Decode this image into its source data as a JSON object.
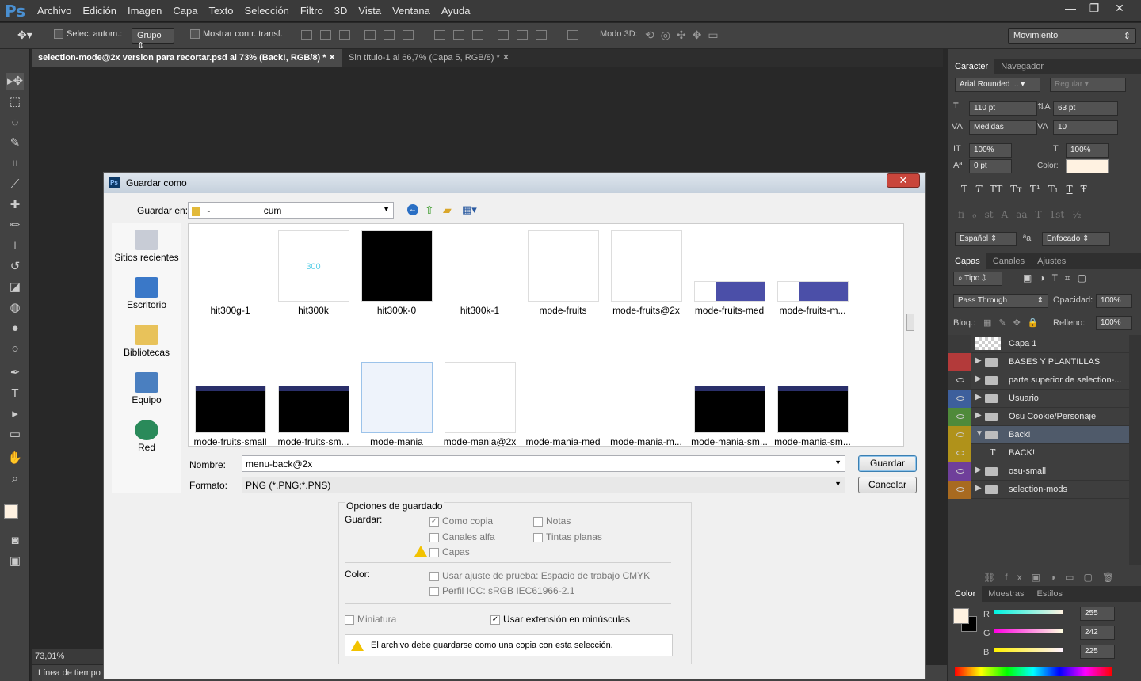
{
  "app": {
    "logo": "Ps"
  },
  "menu": [
    "Archivo",
    "Edición",
    "Imagen",
    "Capa",
    "Texto",
    "Selección",
    "Filtro",
    "3D",
    "Vista",
    "Ventana",
    "Ayuda"
  ],
  "window_controls": {
    "minimize": "—",
    "restore": "❐",
    "close": "✕"
  },
  "options": {
    "auto_select_label": "Selec. autom.:",
    "auto_select_value": "Grupo",
    "show_transform_label": "Mostrar contr. transf.",
    "mode3d_label": "Modo 3D:",
    "workspace": "Movimiento"
  },
  "tabs": [
    {
      "label": "selection-mode@2x version para recortar.psd al 73% (Back!, RGB/8) *",
      "close": "✕"
    },
    {
      "label": "Sin título-1 al 66,7% (Capa 5, RGB/8) *",
      "close": "✕"
    }
  ],
  "status": {
    "zoom": "73,01%",
    "timeline": "Línea de tiempo"
  },
  "character_panel": {
    "tabs": [
      "Carácter",
      "Navegador"
    ],
    "font_family": "Arial Rounded ...",
    "font_style": "Regular",
    "size": "110 pt",
    "leading": "63 pt",
    "kerning": "Medidas",
    "tracking": "10",
    "vscale": "100%",
    "hscale": "100%",
    "baseline": "0 pt",
    "color_label": "Color:",
    "color_value": "#fff2e1",
    "style_buttons": [
      "T",
      "T",
      "TT",
      "Tт",
      "T¹",
      "T₁",
      "T",
      "Ŧ"
    ],
    "opentype_buttons": [
      "fi",
      "ℴ",
      "st",
      "A",
      "aa",
      "T",
      "1st",
      "½"
    ],
    "language": "Español",
    "antialias_icon": "ªa",
    "antialias": "Enfocado"
  },
  "layers_panel": {
    "tabs": [
      "Capas",
      "Canales",
      "Ajustes"
    ],
    "filter": "Tipo",
    "blend_mode": "Pass Through",
    "opacity_label": "Opacidad:",
    "opacity": "100%",
    "lock_label": "Bloq.:",
    "fill_label": "Relleno:",
    "fill": "100%",
    "layers": [
      {
        "name": "Capa 1",
        "kind": "pixel",
        "color": "none",
        "visible": false
      },
      {
        "name": "BASES Y PLANTILLAS",
        "kind": "group",
        "color": "#b33a3a",
        "visible": false
      },
      {
        "name": "parte superior de selection-...",
        "kind": "group",
        "color": "none",
        "visible": true
      },
      {
        "name": "Usuario",
        "kind": "group",
        "color": "#3d5f9c",
        "visible": true
      },
      {
        "name": "Osu Cookie/Personaje",
        "kind": "group",
        "color": "#4f8a3a",
        "visible": true
      },
      {
        "name": "Back!",
        "kind": "group-open",
        "color": "#b0921a",
        "visible": true
      },
      {
        "name": "BACK!",
        "kind": "text",
        "color": "#b0921a",
        "visible": true
      },
      {
        "name": "osu-small",
        "kind": "group",
        "color": "#6f3f9a",
        "visible": true
      },
      {
        "name": "selection-mods",
        "kind": "group",
        "color": "#a86a20",
        "visible": true
      }
    ]
  },
  "color_panel": {
    "tabs": [
      "Color",
      "Muestras",
      "Estilos"
    ],
    "r_label": "R",
    "r": "255",
    "g_label": "G",
    "g": "242",
    "b_label": "B",
    "b": "225",
    "fraction_r": 1.0,
    "fraction_g": 0.949,
    "fraction_b": 0.882
  },
  "dialog": {
    "title": "Guardar como",
    "ps_icon": "Ps",
    "close": "✕",
    "save_in_label": "Guardar en:",
    "save_in_value": "-",
    "save_in_suffix": "cum",
    "places": [
      "Sitios recientes",
      "Escritorio",
      "Bibliotecas",
      "Equipo",
      "Red"
    ],
    "files_row1": [
      {
        "name": "hit300g-1",
        "thumb": "dot"
      },
      {
        "name": "hit300k",
        "thumb": "text",
        "thumb_text": "300"
      },
      {
        "name": "hit300k-0",
        "thumb": "black"
      },
      {
        "name": "hit300k-1",
        "thumb": "dot"
      },
      {
        "name": "mode-fruits",
        "thumb": "white"
      },
      {
        "name": "mode-fruits@2x",
        "thumb": "white"
      },
      {
        "name": "mode-fruits-med",
        "thumb": "image"
      },
      {
        "name": "mode-fruits-m...",
        "thumb": "image"
      }
    ],
    "files_row2": [
      {
        "name": "mode-fruits-small",
        "thumb": "dark"
      },
      {
        "name": "mode-fruits-sm...",
        "thumb": "dark"
      },
      {
        "name": "mode-mania",
        "thumb": "mania"
      },
      {
        "name": "mode-mania@2x",
        "thumb": "white"
      },
      {
        "name": "mode-mania-med",
        "thumb": "dot"
      },
      {
        "name": "mode-mania-m...",
        "thumb": "dot"
      },
      {
        "name": "mode-mania-sm...",
        "thumb": "dark"
      },
      {
        "name": "mode-mania-sm...",
        "thumb": "dark"
      }
    ],
    "name_label": "Nombre:",
    "name_value": "menu-back@2x",
    "format_label": "Formato:",
    "format_value": "PNG (*.PNG;*.PNS)",
    "save_button": "Guardar",
    "cancel_button": "Cancelar",
    "options_title": "Opciones de guardado",
    "save_label": "Guardar:",
    "as_copy": "Como copia",
    "notes": "Notas",
    "alpha": "Canales alfa",
    "spot": "Tintas planas",
    "layers": "Capas",
    "color_label": "Color:",
    "proof": "Usar ajuste de prueba: Espacio de trabajo CMYK",
    "icc": "Perfil ICC: sRGB IEC61966-2.1",
    "thumbnail": "Miniatura",
    "lowercase": "Usar extensión en minúsculas",
    "warning": "El archivo debe guardarse como una copia con esta selección."
  }
}
